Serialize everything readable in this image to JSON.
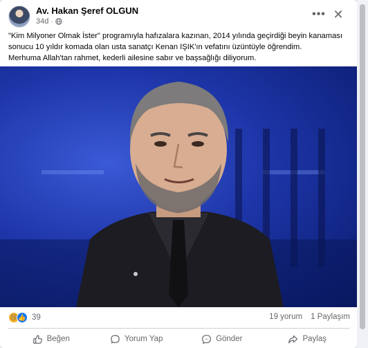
{
  "post": {
    "author": "Av. Hakan Şeref OLGUN",
    "time": "34d",
    "separator": "·",
    "more_label": "•••",
    "close_label": "✕",
    "lines": [
      "\"Kim Milyoner Olmak İster\" programıyla hafızalara kazınan, 2014 yılında geçirdiği beyin kanaması",
      "sonucu 10 yıldır komada olan usta sanatçı Kenan IŞIK'ın vefatını üzüntüyle öğrendim.",
      "Merhuma Allah'tan rahmet, kederli ailesine sabır ve başsağlığı diliyorum."
    ]
  },
  "stats": {
    "reaction_count": "39",
    "comments": "19 yorum",
    "shares": "1 Paylaşım",
    "sad_emoji": "😢",
    "like_emoji": "👍"
  },
  "actions": {
    "like": "Beğen",
    "comment": "Yorum Yap",
    "send": "Gönder",
    "share": "Paylaş"
  },
  "colors": {
    "brand_blue": "#1877f2",
    "secondary_text": "#65676b",
    "photo_bg": "#1d35a8"
  }
}
